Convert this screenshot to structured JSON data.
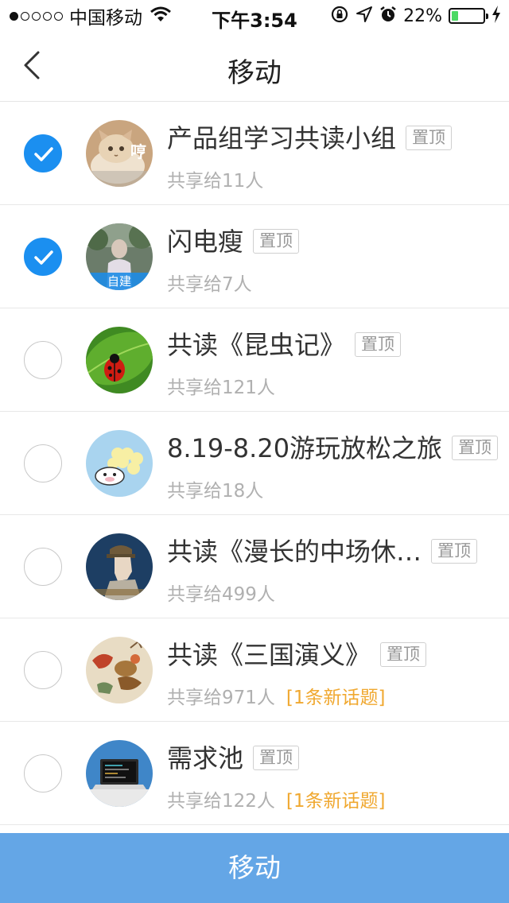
{
  "status_bar": {
    "carrier": "中国移动",
    "time": "下午3:54",
    "battery_percent": "22%",
    "battery_level": 0.22,
    "signal_bars_filled": 1,
    "signal_bars_total": 5,
    "icons": [
      "wifi-icon",
      "orientation-lock-icon",
      "location-arrow-icon",
      "alarm-icon",
      "battery-icon",
      "charging-bolt-icon"
    ]
  },
  "nav": {
    "title": "移动",
    "back_icon": "chevron-left-icon"
  },
  "pin_label": "置顶",
  "groups": [
    {
      "name": "产品组学习共读小组",
      "meta": "共享给11人",
      "pinned": true,
      "checked": true,
      "self_built_badge": "",
      "avatar_text": "哼",
      "avatar_icon": "cat-photo",
      "new_topic": ""
    },
    {
      "name": "闪电瘦",
      "meta": "共享给7人",
      "pinned": true,
      "checked": true,
      "self_built_badge": "自建",
      "avatar_text": "",
      "avatar_icon": "person-photo",
      "new_topic": ""
    },
    {
      "name": "共读《昆虫记》",
      "meta": "共享给121人",
      "pinned": true,
      "checked": false,
      "self_built_badge": "",
      "avatar_text": "",
      "avatar_icon": "ladybug-photo",
      "new_topic": ""
    },
    {
      "name": "8.19-8.20游玩放松之旅",
      "meta": "共享给18人",
      "pinned": true,
      "checked": false,
      "self_built_badge": "",
      "avatar_text": "",
      "avatar_icon": "cartoon-sheep",
      "new_topic": ""
    },
    {
      "name": "共读《漫长的中场休…",
      "meta": "共享给499人",
      "pinned": true,
      "checked": false,
      "self_built_badge": "",
      "avatar_text": "",
      "avatar_icon": "book-cover",
      "new_topic": ""
    },
    {
      "name": "共读《三国演义》",
      "meta": "共享给971人",
      "pinned": true,
      "checked": false,
      "self_built_badge": "",
      "avatar_text": "",
      "avatar_icon": "painting",
      "new_topic": "[1条新话题]"
    },
    {
      "name": "需求池",
      "meta": "共享给122人",
      "pinned": true,
      "checked": false,
      "self_built_badge": "",
      "avatar_text": "",
      "avatar_icon": "laptop-desk",
      "new_topic": "[1条新话题]"
    }
  ],
  "colors": {
    "accent": "#1b8ff0",
    "button_bg": "#64a6e6",
    "new_topic": "#f0a830",
    "battery_fill": "#4cd964"
  },
  "footer": {
    "move_label": "移动"
  }
}
